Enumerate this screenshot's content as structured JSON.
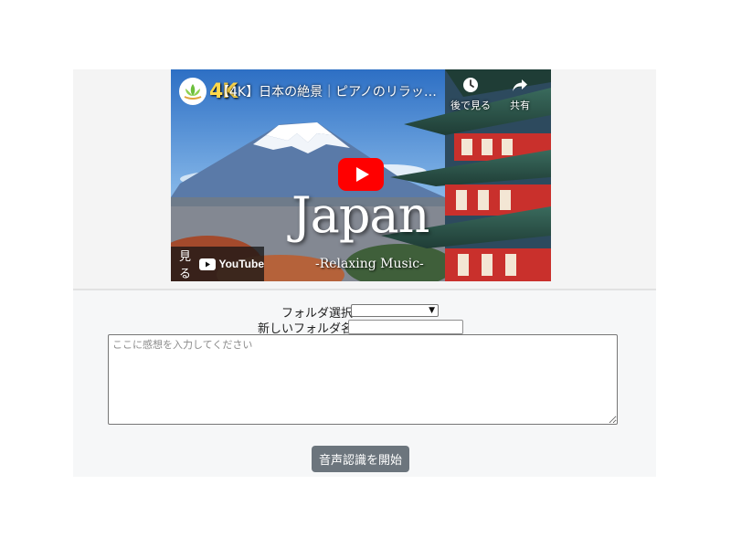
{
  "video": {
    "badge": "4K",
    "title": "【4K】日本の絶景｜ピアノのリラックス...",
    "watch_later_label": "後で見る",
    "share_label": "共有",
    "overlay_title": "Japan",
    "overlay_subtitle": "-Relaxing Music-",
    "watch_on_label": "見る",
    "platform_label": "YouTube",
    "play_color": "#ff0000"
  },
  "form": {
    "folder_select_label": "フォルダ選択",
    "folder_select_value": "",
    "new_folder_label": "新しいフォルダ名",
    "new_folder_value": "",
    "comment_placeholder": "ここに感想を入力してください",
    "comment_value": "",
    "start_button_label": "音声認識を開始"
  }
}
